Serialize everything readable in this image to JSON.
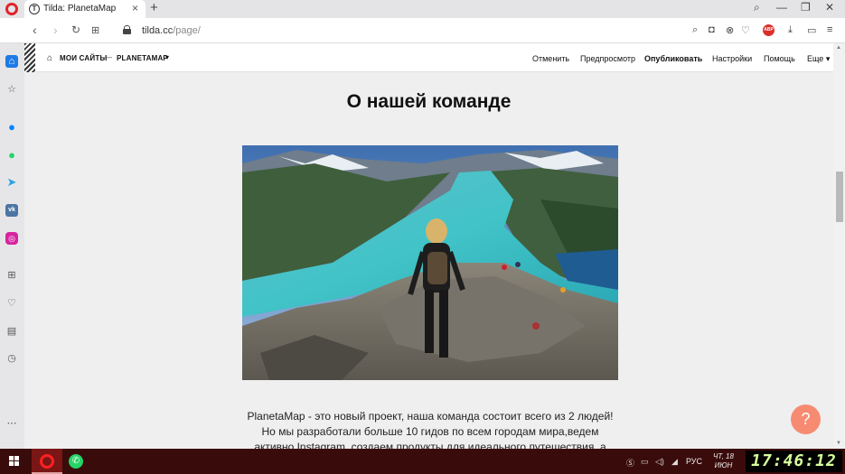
{
  "tab": {
    "title": "Tilda: PlanetaMap",
    "favicon_letter": "T"
  },
  "address": {
    "host": "tilda.cc",
    "path": "/page/"
  },
  "tilda_header": {
    "breadcrumb_root": "МОИ САЙТЫ",
    "breadcrumb_sep": "—",
    "project": "PLANETAMAP",
    "links": [
      {
        "label": "Отменить"
      },
      {
        "label": "Предпросмотр"
      },
      {
        "label": "Опубликовать"
      },
      {
        "label": "Настройки"
      },
      {
        "label": "Помощь"
      },
      {
        "label": "Еще ▾"
      }
    ]
  },
  "content": {
    "heading": "О нашей команде",
    "body": "PlanetaMap - это новый проект, наша команда состоит всего из 2 людей! Но мы разработали больше 10 гидов по всем городам мира,ведем активно Instagram, создаем продукты для идеального путешествия, а самое главное мы приносим"
  },
  "help_button": {
    "label": "?"
  },
  "taskbar": {
    "lang": "РУС",
    "date_line1": "ЧТ, 18",
    "date_line2": "ИЮН",
    "clock": "17:46:12"
  },
  "colors": {
    "accent_help": "#f78b72",
    "taskbar": "#3a0b0b",
    "opera_red": "#e0242a"
  }
}
